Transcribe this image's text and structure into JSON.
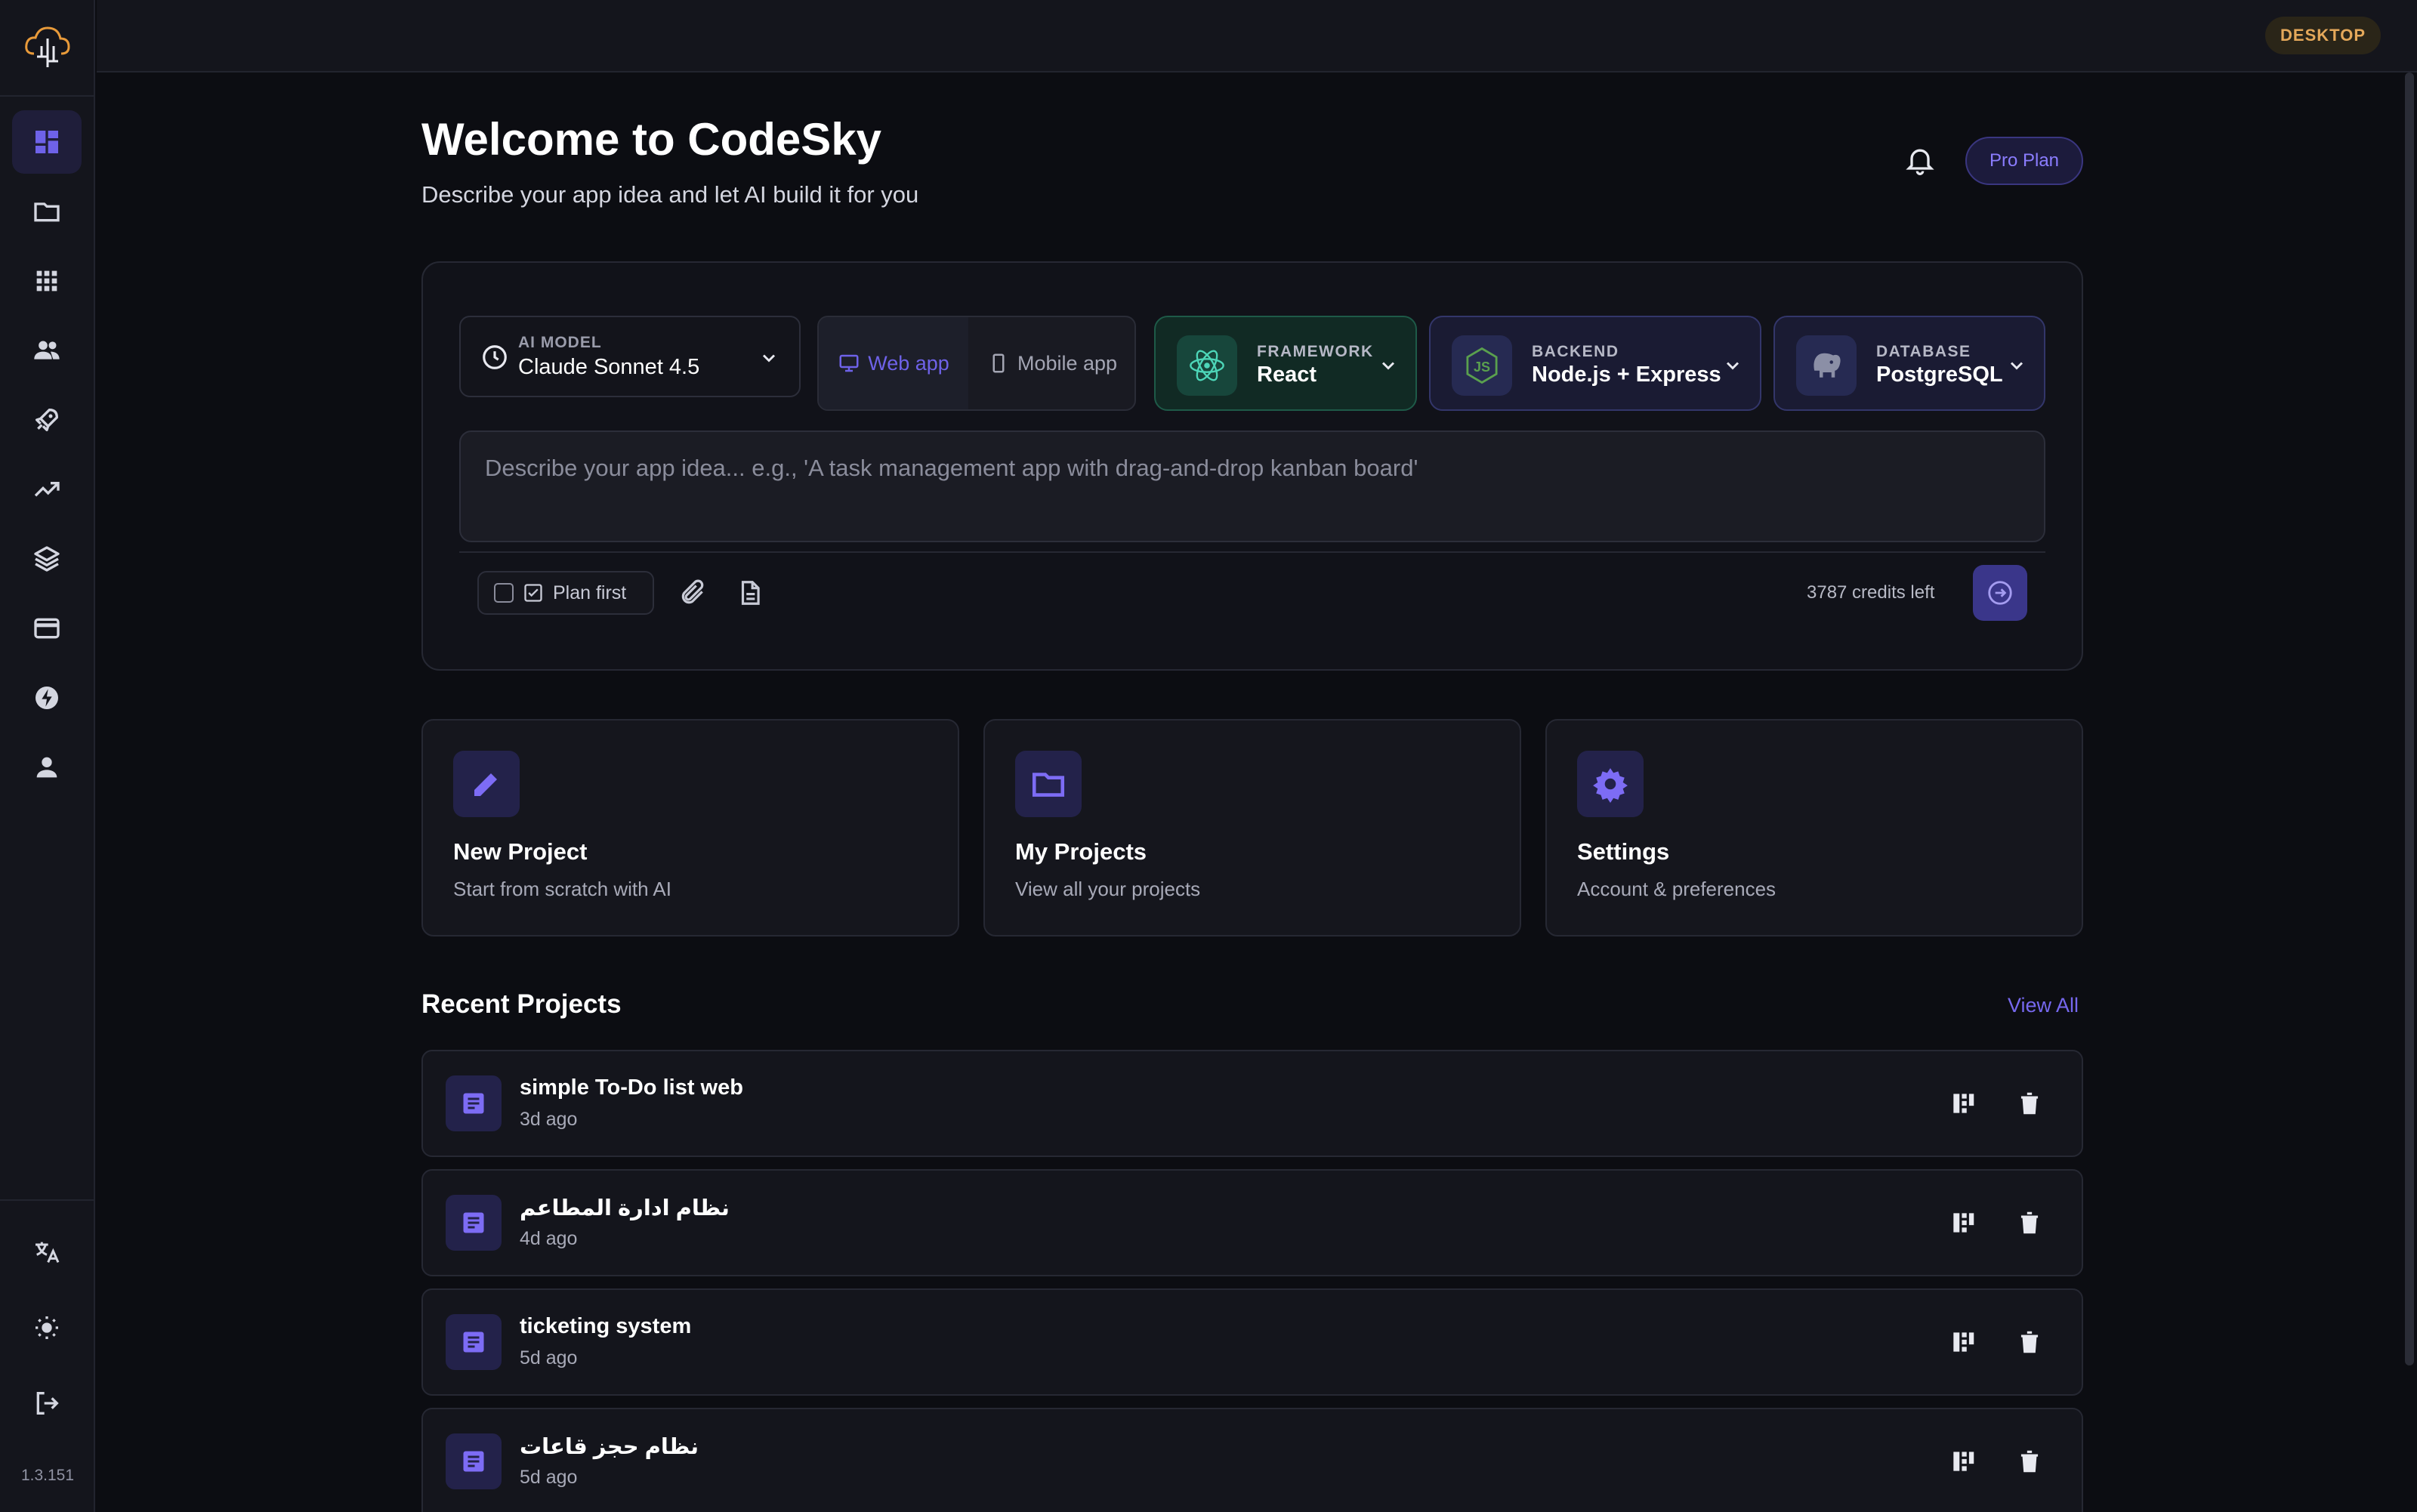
{
  "topbar": {
    "badge": "DESKTOP"
  },
  "sidebar": {
    "version": "1.3.151",
    "items": [
      "dashboard-icon",
      "folder-icon",
      "grid-icon",
      "users-icon",
      "rocket-icon",
      "trending-icon",
      "layers-icon",
      "credit-card-icon",
      "bolt-icon",
      "person-icon"
    ],
    "bottom_items": [
      "translate-icon",
      "sun-icon",
      "logout-icon"
    ]
  },
  "header": {
    "title": "Welcome to CodeSky",
    "subtitle": "Describe your app idea and let AI build it for you",
    "plan_label": "Pro Plan"
  },
  "composer": {
    "model_caption": "AI MODEL",
    "model_value": "Claude Sonnet 4.5",
    "web_label": "Web app",
    "mobile_label": "Mobile app",
    "framework_caption": "FRAMEWORK",
    "framework_value": "React",
    "backend_caption": "BACKEND",
    "backend_value": "Node.js + Express",
    "database_caption": "DATABASE",
    "database_value": "PostgreSQL",
    "prompt_placeholder": "Describe your app idea... e.g., 'A task management app with drag-and-drop kanban board'",
    "plan_first_label": "Plan first",
    "credits": "3787 credits left"
  },
  "actions": [
    {
      "title": "New Project",
      "desc": "Start from scratch with AI"
    },
    {
      "title": "My Projects",
      "desc": "View all your projects"
    },
    {
      "title": "Settings",
      "desc": "Account & preferences"
    }
  ],
  "recent": {
    "title": "Recent Projects",
    "view_all": "View All",
    "projects": [
      {
        "name": "simple To-Do list web",
        "time": "3d ago"
      },
      {
        "name": "نظام ادارة المطاعم",
        "time": "4d ago"
      },
      {
        "name": "ticketing system",
        "time": "5d ago"
      },
      {
        "name": "نظام حجز قاعات",
        "time": "5d ago"
      }
    ]
  },
  "colors": {
    "accent": "#6e62e8",
    "background": "#0c0d12",
    "warning": "#e4a85a",
    "framework_green": "#1e5a48"
  }
}
